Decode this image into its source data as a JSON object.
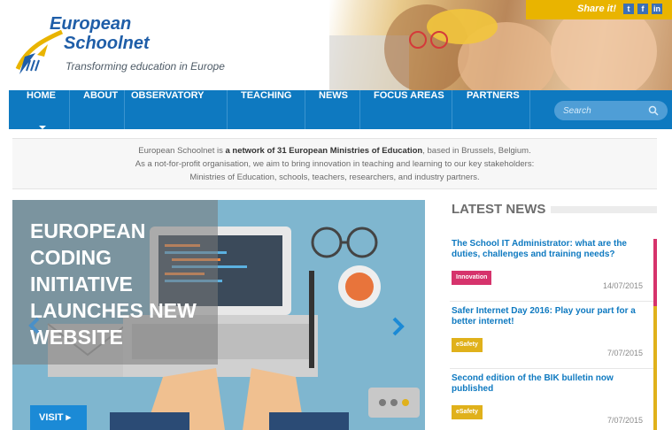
{
  "brand": {
    "name_line1": "European",
    "name_line2": "Schoolnet",
    "tagline": "Transforming education in Europe"
  },
  "share": {
    "label": "Share it!",
    "icons": [
      "twitter-icon",
      "facebook-icon",
      "linkedin-icon"
    ],
    "twitter_glyph": "t",
    "facebook_glyph": "f",
    "linkedin_glyph": "in"
  },
  "nav": {
    "items": [
      "HOME",
      "ABOUT",
      "OBSERVATORY",
      "TEACHING",
      "NEWS",
      "FOCUS AREAS",
      "PARTNERS"
    ],
    "active": "HOME"
  },
  "search": {
    "placeholder": "Search"
  },
  "intro": {
    "line1_pre": "European Schoolnet is ",
    "line1_bold": "a network of 31 European Ministries of Education",
    "line1_post": ", based in Brussels, Belgium.",
    "line2": "As a not-for-profit organisation, we aim to bring innovation in teaching and learning to our key stakeholders:",
    "line3": "Ministries of Education, schools, teachers, researchers, and industry partners."
  },
  "slider": {
    "title": "European Coding Initiative Launches New Website",
    "visit_label": "VISIT ▸"
  },
  "latest_news": {
    "heading": "LATEST NEWS",
    "items": [
      {
        "title": "The School IT Administrator: what are the duties, challenges and training needs?",
        "tag": "Innovation",
        "date": "14/07/2015"
      },
      {
        "title": "Safer Internet Day 2016: Play your part for a better internet!",
        "tag": "eSafety",
        "date": "7/07/2015"
      },
      {
        "title": "Second edition of the BIK bulletin now published",
        "tag": "eSafety",
        "date": "7/07/2015"
      }
    ]
  },
  "colors": {
    "brand_blue": "#0e79c0",
    "innovation_tag": "#d6336c",
    "esafety_tag": "#e0b11b",
    "share_bar": "#e9b400"
  }
}
